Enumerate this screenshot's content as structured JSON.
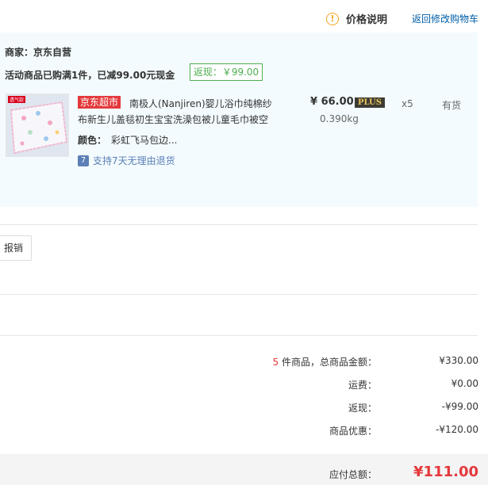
{
  "top_links": {
    "price_info": "价格说明",
    "back_to_cart": "返回修改购物车"
  },
  "order": {
    "merchant": "商家：京东自营",
    "promo": "活动商品已购满1件，已减99.00元现金",
    "rebate_badge": "返现：￥99.00",
    "item": {
      "thumb_tag": "透气款",
      "store_badge": "京东超市",
      "title_line1": "南极人(Nanjiren)婴儿浴巾纯棉纱",
      "title_line2": "布新生儿盖毯初生宝宝洗澡包被儿童毛巾被空",
      "color_label": "颜色：",
      "color_value": "彩虹飞马包边...",
      "return_icon": "7",
      "return_text": "支持7天无理由退货",
      "price": "¥ 66.00",
      "plus_badge": "PLUS",
      "weight": "0.390kg",
      "quantity": "x5",
      "stock": "有货"
    }
  },
  "invoice": {
    "button_label": "报销"
  },
  "summary": {
    "count": "5",
    "count_suffix": " 件商品，总商品金额：",
    "total_goods": "¥330.00",
    "shipping_label": "运费：",
    "shipping": "¥0.00",
    "rebate_label": "返现：",
    "rebate": "-¥99.00",
    "discount_label": "商品优惠：",
    "discount": "-¥120.00",
    "payable_label": "应付总额：",
    "payable": "¥111.00"
  },
  "colors": {
    "accent_red": "#e4393c",
    "link_blue": "#005ea7",
    "rebate_green": "#4caf50",
    "order_bg": "#f3fbfe"
  }
}
